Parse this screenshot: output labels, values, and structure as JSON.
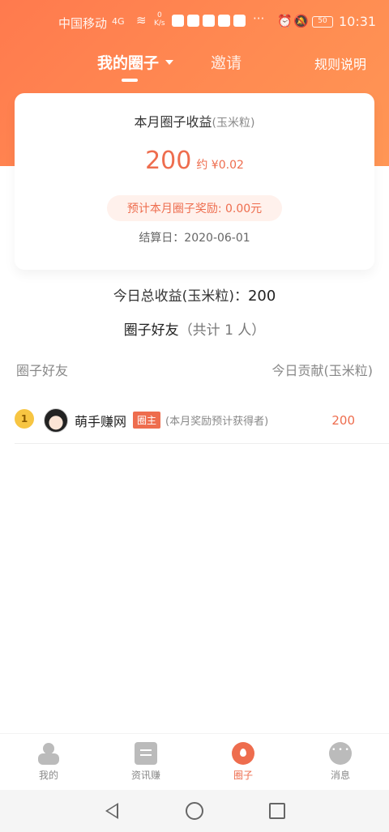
{
  "status_bar": {
    "carrier": "中国移动",
    "signal": "4G",
    "net_speed_value": "0",
    "net_speed_unit": "K/s",
    "battery": "50",
    "time": "10:31"
  },
  "top_nav": {
    "my_circle": "我的圈子",
    "invite": "邀请",
    "rules": "规则说明"
  },
  "earnings_card": {
    "title": "本月圈子收益",
    "title_unit": "(玉米粒)",
    "amount": "200",
    "approx": "约 ¥0.02",
    "reward_pill": "预计本月圈子奖励: 0.00元",
    "settlement_date": "结算日：2020-06-01"
  },
  "summary": {
    "today_label": "今日总收益(玉米粒)：",
    "today_value": "200",
    "friends_label": "圈子好友",
    "friends_count": "（共计 1 人）"
  },
  "list": {
    "col_friend": "圈子好友",
    "col_contribution": "今日贡献(玉米粒)",
    "rows": [
      {
        "rank": "1",
        "name": "萌手赚网",
        "tag": "圈主",
        "note": "(本月奖励预计获得者)",
        "contribution": "200"
      }
    ]
  },
  "tab_bar": {
    "items": [
      {
        "label": "我的",
        "icon": "person-icon"
      },
      {
        "label": "资讯赚",
        "icon": "news-icon"
      },
      {
        "label": "圈子",
        "icon": "circle-icon"
      },
      {
        "label": "消息",
        "icon": "message-icon"
      }
    ],
    "active_index": 2
  },
  "colors": {
    "accent": "#ee6d4e",
    "header_gradient_start": "#ff7a4e",
    "header_gradient_end": "#ff9655"
  }
}
